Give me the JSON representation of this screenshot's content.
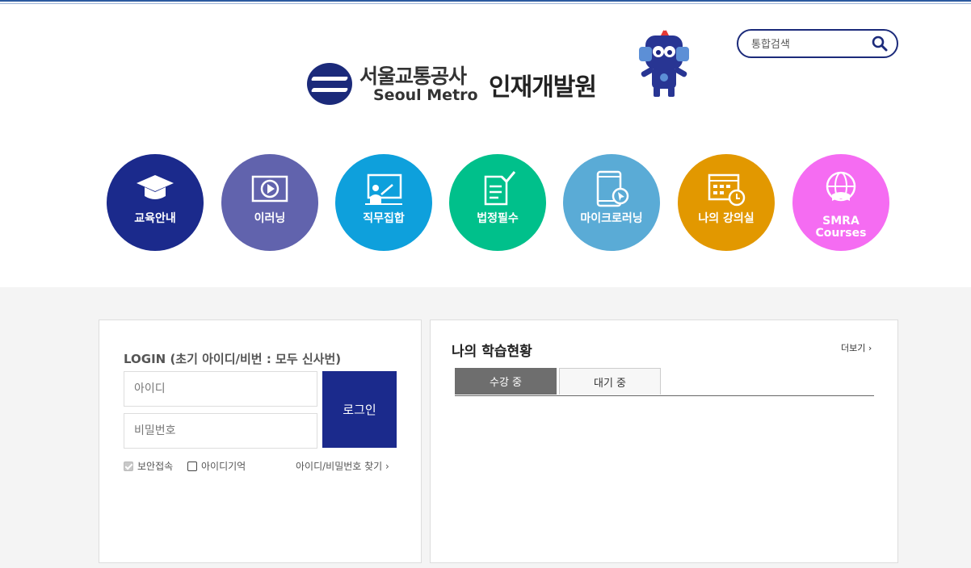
{
  "header": {
    "logo_korean": "서울교통공사",
    "logo_english": "Seoul Metro",
    "logo_subtitle": "인재개발원",
    "search_placeholder": "통합검색"
  },
  "nav": {
    "items": [
      {
        "label": "교육안내",
        "color": "#1b2a8c",
        "icon": "graduation-cap-icon"
      },
      {
        "label": "이러닝",
        "color": "#6163ad",
        "icon": "play-screen-icon"
      },
      {
        "label": "직무집합",
        "color": "#0ea0dc",
        "icon": "classroom-board-icon"
      },
      {
        "label": "법정필수",
        "color": "#00c08b",
        "icon": "checklist-icon"
      },
      {
        "label": "마이크로러닝",
        "color": "#5aabd6",
        "icon": "tablet-cursor-icon"
      },
      {
        "label": "나의 강의실",
        "color": "#e29800",
        "icon": "calendar-clock-icon"
      },
      {
        "label_line1": "SMRA",
        "label_line2": "Courses",
        "color": "#f56cf2",
        "icon": "globe-book-icon"
      }
    ]
  },
  "login": {
    "title": "LOGIN (초기 아이디/비번 : 모두 신사번)",
    "id_placeholder": "아이디",
    "password_placeholder": "비밀번호",
    "login_button": "로그인",
    "secure_label": "보안접속",
    "remember_label": "아이디기억",
    "find_link": "아이디/비밀번호 찾기 ›"
  },
  "status": {
    "title": "나의 학습현황",
    "more_link": "더보기 ›",
    "tabs": [
      "수강 중",
      "대기 중"
    ]
  }
}
